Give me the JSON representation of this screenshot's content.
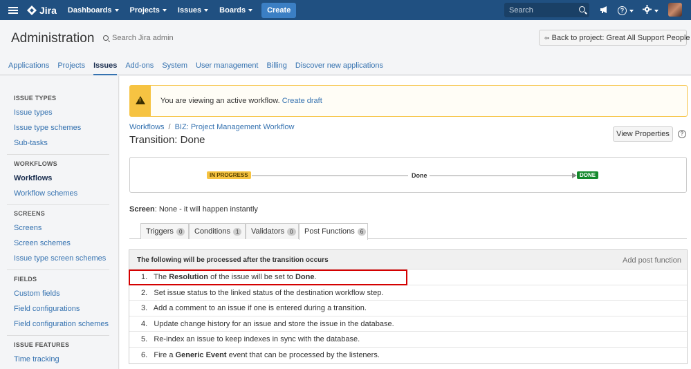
{
  "topbar": {
    "logo": "Jira",
    "nav": [
      "Dashboards",
      "Projects",
      "Issues",
      "Boards"
    ],
    "create": "Create",
    "search_placeholder": "Search",
    "help_icon": "?",
    "accent": "#205081"
  },
  "header": {
    "title": "Administration",
    "search": "Search Jira admin",
    "back_button": "Back to project: Great All Support People"
  },
  "admin_tabs": [
    {
      "label": "Applications",
      "active": false
    },
    {
      "label": "Projects",
      "active": false
    },
    {
      "label": "Issues",
      "active": true
    },
    {
      "label": "Add-ons",
      "active": false
    },
    {
      "label": "System",
      "active": false
    },
    {
      "label": "User management",
      "active": false
    },
    {
      "label": "Billing",
      "active": false
    },
    {
      "label": "Discover new applications",
      "active": false
    }
  ],
  "sidebar": {
    "sections": [
      {
        "heading": "ISSUE TYPES",
        "items": [
          "Issue types",
          "Issue type schemes",
          "Sub-tasks"
        ]
      },
      {
        "heading": "WORKFLOWS",
        "items": [
          "Workflows",
          "Workflow schemes"
        ],
        "active": "Workflows"
      },
      {
        "heading": "SCREENS",
        "items": [
          "Screens",
          "Screen schemes",
          "Issue type screen schemes"
        ]
      },
      {
        "heading": "FIELDS",
        "items": [
          "Custom fields",
          "Field configurations",
          "Field configuration schemes"
        ]
      },
      {
        "heading": "ISSUE FEATURES",
        "items": [
          "Time tracking"
        ]
      }
    ]
  },
  "main": {
    "warning": {
      "text": "You are viewing an active workflow.",
      "link": "Create draft"
    },
    "breadcrumb": {
      "root": "Workflows",
      "sep": "/",
      "workflow": "BIZ: Project Management Workflow"
    },
    "title": "Transition: Done",
    "view_properties": "View Properties",
    "diagram": {
      "from": "IN PROGRESS",
      "transition": "Done",
      "to": "DONE"
    },
    "screen": {
      "label": "Screen",
      "value": ": None - it will happen instantly"
    },
    "tabs": [
      {
        "label": "Triggers",
        "count": "0"
      },
      {
        "label": "Conditions",
        "count": "1"
      },
      {
        "label": "Validators",
        "count": "0"
      },
      {
        "label": "Post Functions",
        "count": "6",
        "active": true
      }
    ],
    "post_functions": {
      "heading": "The following will be processed after the transition occurs",
      "add": "Add post function",
      "rows": [
        {
          "n": "1.",
          "a": "The ",
          "b": "Resolution",
          "c": " of the issue will be set to ",
          "d": "Done",
          "e": "."
        },
        {
          "n": "2.",
          "a": "Set issue status to the linked status of the destination workflow step.",
          "b": "",
          "c": "",
          "d": "",
          "e": ""
        },
        {
          "n": "3.",
          "a": "Add a comment to an issue if one is entered during a transition.",
          "b": "",
          "c": "",
          "d": "",
          "e": ""
        },
        {
          "n": "4.",
          "a": "Update change history for an issue and store the issue in the database.",
          "b": "",
          "c": "",
          "d": "",
          "e": ""
        },
        {
          "n": "5.",
          "a": "Re-index an issue to keep indexes in sync with the database.",
          "b": "",
          "c": "",
          "d": "",
          "e": ""
        },
        {
          "n": "6.",
          "a": "Fire a ",
          "b": "Generic Event",
          "c": " event that can be processed by the listeners.",
          "d": "",
          "e": ""
        }
      ]
    }
  }
}
